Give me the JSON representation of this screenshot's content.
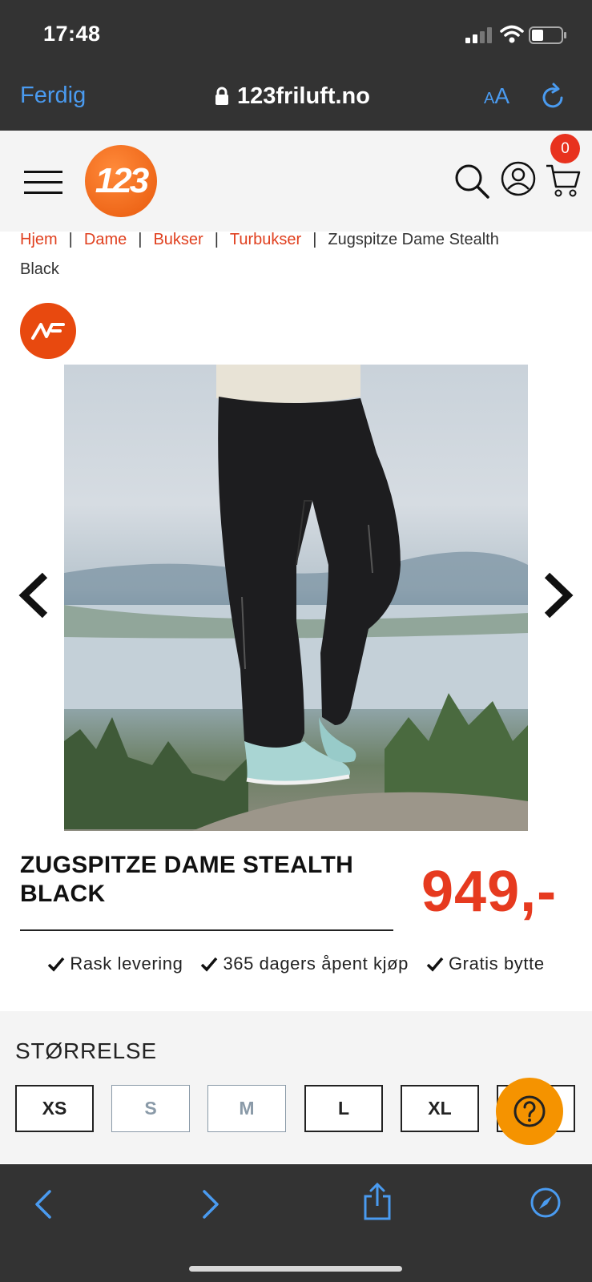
{
  "status_bar": {
    "time": "17:48"
  },
  "browser": {
    "done_label": "Ferdig",
    "url": "123friluft.no",
    "text_size_label_small": "A",
    "text_size_label_large": "A"
  },
  "header": {
    "logo_text": "123",
    "cart_count": "0",
    "accent_color": "#e8590c"
  },
  "breadcrumb": {
    "items": [
      "Hjem",
      "Dame",
      "Bukser",
      "Turbukser"
    ],
    "separator": "|",
    "current_line1": "Zugspitze Dame Stealth",
    "current_line2": "Black"
  },
  "product": {
    "title": "ZUGSPITZE DAME STEALTH BLACK",
    "price": "949,-",
    "price_color": "#e63a1f"
  },
  "usps": [
    "Rask levering",
    "365 dagers åpent kjøp",
    "Gratis bytte"
  ],
  "sizes": {
    "heading": "STØRRELSE",
    "options": [
      {
        "label": "XS",
        "available": true
      },
      {
        "label": "S",
        "available": false
      },
      {
        "label": "M",
        "available": false
      },
      {
        "label": "L",
        "available": true
      },
      {
        "label": "XL",
        "available": true
      },
      {
        "label": "",
        "available": true
      }
    ]
  }
}
